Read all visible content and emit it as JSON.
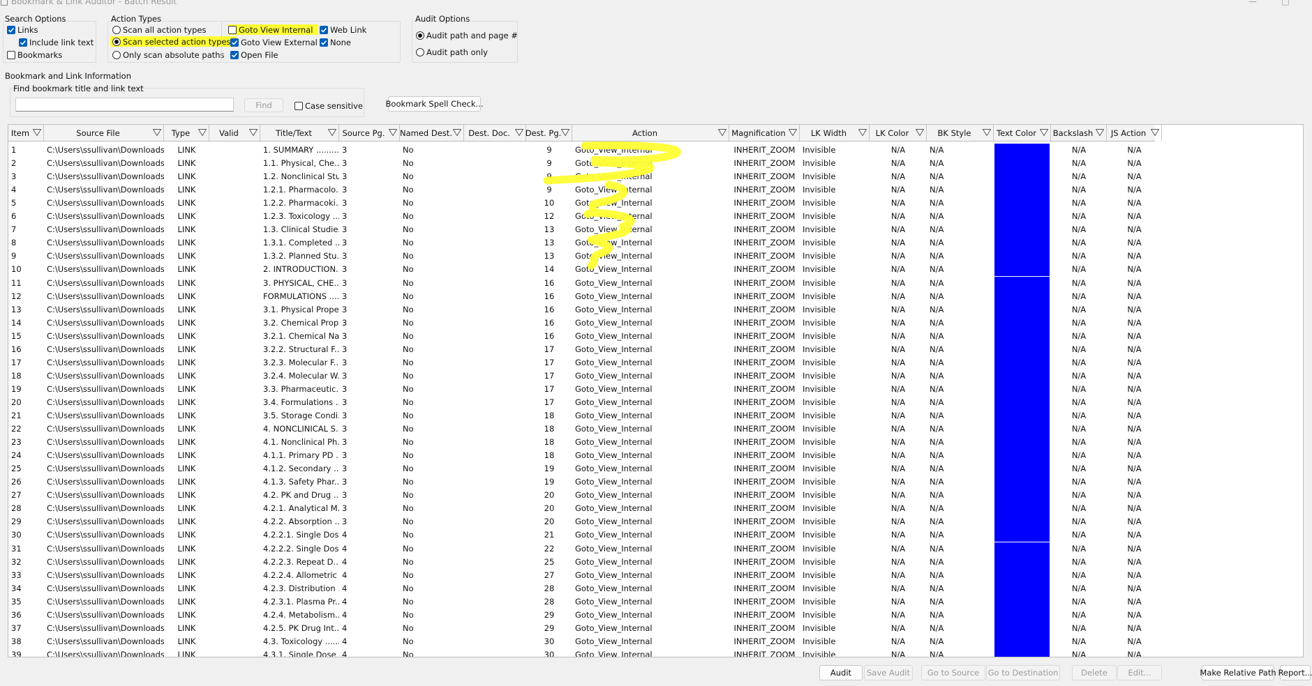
{
  "window": {
    "title": "Bookmark & Link Auditor - Batch Result"
  },
  "search_options": {
    "title": "Search Options",
    "links": {
      "label": "Links",
      "checked": true
    },
    "include_link_text": {
      "label": "Include link text",
      "checked": true
    },
    "bookmarks": {
      "label": "Bookmarks",
      "checked": false
    }
  },
  "action_types": {
    "title": "Action Types",
    "scan_all": {
      "label": "Scan all action types",
      "selected": false
    },
    "scan_selected": {
      "label": "Scan selected action types",
      "selected": true
    },
    "absolute_paths": {
      "label": "Only scan absolute paths",
      "selected": false
    },
    "goto_view_internal": {
      "label": "Goto View Internal",
      "checked": false
    },
    "goto_view_external": {
      "label": "Goto View External",
      "checked": true
    },
    "open_file": {
      "label": "Open File",
      "checked": true
    },
    "web_link": {
      "label": "Web Link",
      "checked": true
    },
    "none": {
      "label": "None",
      "checked": true
    }
  },
  "audit_options": {
    "title": "Audit Options",
    "path_and_page": {
      "label": "Audit path and page #",
      "selected": true
    },
    "path_only": {
      "label": "Audit path only",
      "selected": false
    }
  },
  "bookmark_link_info": {
    "title": "Bookmark and Link Information",
    "find_group_title": "Find bookmark title and link text",
    "find_input_value": "",
    "find_button": "Find",
    "case_sensitive": {
      "label": "Case sensitive",
      "checked": false
    },
    "spell_check_button": "Bookmark Spell Check..."
  },
  "table": {
    "columns": [
      "Item",
      "Source File",
      "Type",
      "Valid",
      "Title/Text",
      "Source Pg.",
      "Named Dest.",
      "Dest. Doc.",
      "Dest. Pg.",
      "Action",
      "Magnification",
      "LK Width",
      "LK Color",
      "BK Style",
      "Text Color",
      "Backslash",
      "JS Action"
    ],
    "text_color_swatch": "#0000ff",
    "common": {
      "source_file": "C:\\Users\\ssullivan\\Downloads...",
      "type": "LINK",
      "valid": "",
      "named_dest": "No",
      "dest_doc": "",
      "action": "Goto_View_Internal",
      "magnification": "INHERIT_ZOOM",
      "lk_width": "Invisible",
      "lk_color": "N/A",
      "bk_style": "N/A",
      "backslash": "N/A",
      "js_action": "N/A"
    },
    "rows": [
      {
        "item": "1",
        "title": "1. SUMMARY .........",
        "src_pg": "3",
        "dest_pg": "9"
      },
      {
        "item": "2",
        "title": "1.1. Physical, Che...",
        "src_pg": "3",
        "dest_pg": "9"
      },
      {
        "item": "3",
        "title": "1.2. Nonclinical Stu...",
        "src_pg": "3",
        "dest_pg": "9"
      },
      {
        "item": "4",
        "title": "1.2.1. Pharmacolo...",
        "src_pg": "3",
        "dest_pg": "9"
      },
      {
        "item": "5",
        "title": "1.2.2. Pharmacoki...",
        "src_pg": "3",
        "dest_pg": "10"
      },
      {
        "item": "6",
        "title": "1.2.3. Toxicology ....",
        "src_pg": "3",
        "dest_pg": "12"
      },
      {
        "item": "7",
        "title": "1.3. Clinical Studie...",
        "src_pg": "3",
        "dest_pg": "13"
      },
      {
        "item": "8",
        "title": "1.3.1. Completed ...",
        "src_pg": "3",
        "dest_pg": "13"
      },
      {
        "item": "9",
        "title": "1.3.2. Planned Stu...",
        "src_pg": "3",
        "dest_pg": "13"
      },
      {
        "item": "10",
        "title": "2. INTRODUCTION...",
        "src_pg": "3",
        "dest_pg": "14"
      },
      {
        "item": "11",
        "title": "3. PHYSICAL, CHE...",
        "src_pg": "3",
        "dest_pg": "16"
      },
      {
        "item": "12",
        "title": "FORMULATIONS .....",
        "src_pg": "3",
        "dest_pg": "16"
      },
      {
        "item": "13",
        "title": "3.1. Physical Prope...",
        "src_pg": "3",
        "dest_pg": "16"
      },
      {
        "item": "14",
        "title": "3.2. Chemical Prop...",
        "src_pg": "3",
        "dest_pg": "16"
      },
      {
        "item": "15",
        "title": "3.2.1. Chemical Na...",
        "src_pg": "3",
        "dest_pg": "16"
      },
      {
        "item": "16",
        "title": "3.2.2. Structural F...",
        "src_pg": "3",
        "dest_pg": "17"
      },
      {
        "item": "17",
        "title": "3.2.3. Molecular F...",
        "src_pg": "3",
        "dest_pg": "17"
      },
      {
        "item": "18",
        "title": "3.2.4. Molecular W...",
        "src_pg": "3",
        "dest_pg": "17"
      },
      {
        "item": "19",
        "title": "3.3. Pharmaceutic...",
        "src_pg": "3",
        "dest_pg": "17"
      },
      {
        "item": "20",
        "title": "3.4. Formulations ....",
        "src_pg": "3",
        "dest_pg": "17"
      },
      {
        "item": "21",
        "title": "3.5. Storage Condi...",
        "src_pg": "3",
        "dest_pg": "18"
      },
      {
        "item": "22",
        "title": "4. NONCLINICAL S...",
        "src_pg": "3",
        "dest_pg": "18"
      },
      {
        "item": "23",
        "title": "4.1. Nonclinical Ph...",
        "src_pg": "3",
        "dest_pg": "18"
      },
      {
        "item": "24",
        "title": "4.1.1. Primary PD ....",
        "src_pg": "3",
        "dest_pg": "18"
      },
      {
        "item": "25",
        "title": "4.1.2. Secondary ....",
        "src_pg": "3",
        "dest_pg": "19"
      },
      {
        "item": "26",
        "title": "4.1.3. Safety Phar...",
        "src_pg": "3",
        "dest_pg": "19"
      },
      {
        "item": "27",
        "title": "4.2. PK and Drug ...",
        "src_pg": "3",
        "dest_pg": "20"
      },
      {
        "item": "28",
        "title": "4.2.1. Analytical M...",
        "src_pg": "3",
        "dest_pg": "20"
      },
      {
        "item": "29",
        "title": "4.2.2. Absorption ......",
        "src_pg": "3",
        "dest_pg": "20"
      },
      {
        "item": "30",
        "title": "4.2.2.1. Single Dos...",
        "src_pg": "4",
        "dest_pg": "21"
      },
      {
        "item": "31",
        "title": "4.2.2.2. Single Dos...",
        "src_pg": "4",
        "dest_pg": "22"
      },
      {
        "item": "32",
        "title": "4.2.2.3. Repeat D...",
        "src_pg": "4",
        "dest_pg": "25"
      },
      {
        "item": "33",
        "title": "4.2.2.4. Allometric ...",
        "src_pg": "4",
        "dest_pg": "27"
      },
      {
        "item": "34",
        "title": "4.2.3. Distribution ...",
        "src_pg": "4",
        "dest_pg": "28"
      },
      {
        "item": "35",
        "title": "4.2.3.1. Plasma Pr...",
        "src_pg": "4",
        "dest_pg": "28"
      },
      {
        "item": "36",
        "title": "4.2.4. Metabolism....",
        "src_pg": "4",
        "dest_pg": "29"
      },
      {
        "item": "37",
        "title": "4.2.5. PK Drug Int...",
        "src_pg": "4",
        "dest_pg": "29"
      },
      {
        "item": "38",
        "title": "4.3. Toxicology ......",
        "src_pg": "4",
        "dest_pg": "30"
      },
      {
        "item": "39",
        "title": "4.3.1. Single Dose ...",
        "src_pg": "4",
        "dest_pg": "30"
      }
    ]
  },
  "buttons": {
    "audit": "Audit",
    "save_audit": "Save Audit",
    "go_to_source": "Go to Source",
    "go_to_destination": "Go to Destination",
    "delete": "Delete",
    "edit": "Edit...",
    "make_relative_path": "Make Relative Path",
    "report": "Report..."
  },
  "annotation_color": "#ffff33"
}
